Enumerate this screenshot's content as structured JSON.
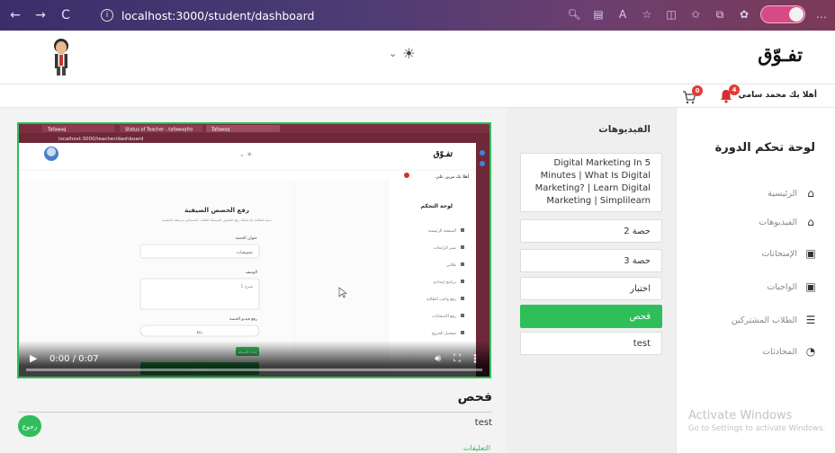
{
  "browser": {
    "url": "localhost:3000/student/dashboard",
    "back_glyph": "←",
    "forward_glyph": "→",
    "reload_glyph": "C",
    "info_glyph": "i"
  },
  "header": {
    "brand": "تفـوّق",
    "theme_icon": "☀",
    "chevron": "⌄"
  },
  "subheader": {
    "greeting": "أهلا بك محمد سامي",
    "notifications_count": "4",
    "cart_count": "0"
  },
  "sidebar": {
    "title": "لوحة تحكم الدورة",
    "items": [
      {
        "label": "الرئيسية",
        "icon": "home-icon"
      },
      {
        "label": "الفيديوهات",
        "icon": "video-icon"
      },
      {
        "label": "الإمتحانات",
        "icon": "exam-icon"
      },
      {
        "label": "الواجبات",
        "icon": "homework-icon"
      },
      {
        "label": "الطلاب المشتركين",
        "icon": "students-icon"
      },
      {
        "label": "المحادثات",
        "icon": "chat-icon"
      }
    ]
  },
  "videos": {
    "title": "الفيديوهات",
    "items": [
      {
        "label": "Digital Marketing In 5 Minutes | What Is Digital Marketing? | Learn Digital Marketing | Simplilearn",
        "active": false
      },
      {
        "label": "حصة 2",
        "active": false
      },
      {
        "label": "حصة 3",
        "active": false
      },
      {
        "label": "اختبار",
        "active": false
      },
      {
        "label": "فحص",
        "active": true
      },
      {
        "label": "test",
        "active": false
      }
    ]
  },
  "player": {
    "time": "0:00 / 0:07",
    "progress": 0.0,
    "inner": {
      "tab1": "Tafawoq",
      "tab2": "Status of Teacher - tafawoqfro",
      "tab3": "Tafawoq",
      "url": "localhost:3000/teacher/dashboard",
      "brand": "تفـوّق",
      "greeting": "أهلا بك مرين علي",
      "sidebar_title": "لوحة التحكم",
      "side_items": [
        "الصفحة الرئيسية",
        "نشر الرابحات",
        "طلابي",
        "برنامج إمدادي",
        "رفع واجب الطالبة",
        "رفع الامتحانات",
        "تسجيل الخروج"
      ],
      "form_title": "رفع الحصص الصيفية",
      "form_sub": "سعيد للطالبة هنا يمكنك رفع الحصص المسجلة للطالب المسجلين مرتبطة التعليمية",
      "f1_label": "عنوان الحصة",
      "f1_value": "تسويقيات",
      "f2_label": "الوصف",
      "f2_value": "شرح 1",
      "f3_label": "رفع فيديو الحصة",
      "f3_value": "رفع",
      "btn1": "إعادة الصياغة",
      "btn2": "رفع الحصة"
    }
  },
  "content": {
    "title": "فحص",
    "description": "test",
    "back_label": "رجوع",
    "next_label": "التعليقات"
  },
  "watermark": {
    "line1": "Activate Windows",
    "line2": "Go to Settings to activate Windows."
  },
  "colors": {
    "accent": "#2fbf5a",
    "badge": "#e53935",
    "browser_bar": "#4a3b74",
    "inner_browser": "#7a2f3f"
  }
}
